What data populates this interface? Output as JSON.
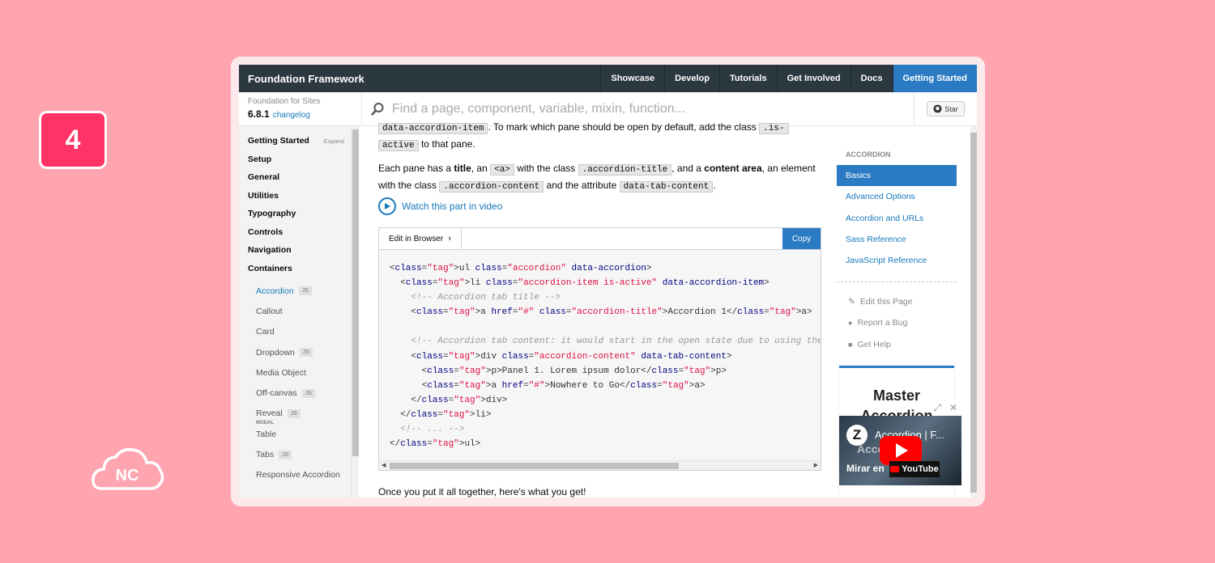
{
  "badge": "4",
  "logo": "NC",
  "topbar": {
    "brand": "Foundation Framework",
    "nav": [
      "Showcase",
      "Develop",
      "Tutorials",
      "Get Involved",
      "Docs"
    ],
    "active": "Getting Started"
  },
  "version": {
    "label": "Foundation for Sites",
    "number": "6.8.1",
    "changelog": "changelog"
  },
  "search": {
    "placeholder": "Find a page, component, variable, mixin, function..."
  },
  "github": {
    "star": "Star"
  },
  "sidebar": {
    "categories": [
      {
        "label": "Getting Started",
        "expand": "Expand"
      },
      {
        "label": "Setup"
      },
      {
        "label": "General"
      },
      {
        "label": "Utilities"
      },
      {
        "label": "Typography"
      },
      {
        "label": "Controls"
      },
      {
        "label": "Navigation"
      },
      {
        "label": "Containers"
      }
    ],
    "items": [
      {
        "label": "Accordion",
        "badge": "JS"
      },
      {
        "label": "Callout"
      },
      {
        "label": "Card"
      },
      {
        "label": "Dropdown",
        "badge": "JS"
      },
      {
        "label": "Media Object"
      },
      {
        "label": "Off-canvas",
        "badge": "JS"
      },
      {
        "label": "Reveal",
        "badge": "JS",
        "sub": "MODAL"
      },
      {
        "label": "Table"
      },
      {
        "label": "Tabs",
        "badge": "JS"
      },
      {
        "label": "Responsive Accordion"
      }
    ]
  },
  "main": {
    "p0": {
      "code1": "data-accordion-item",
      "text1": ". To mark which pane should be open by default, add the class ",
      "code2": ".is-",
      "code3": "active",
      "text2": " to that pane."
    },
    "p1": {
      "t1": "Each pane has a ",
      "b1": "title",
      "t2": ", an ",
      "c1": "<a>",
      "t3": " with the class ",
      "c2": ".accordion-title",
      "t4": ", and a ",
      "b2": "content area",
      "t5": ", an element with the class ",
      "c3": ".accordion-content",
      "t6": " and the attribute ",
      "c4": "data-tab-content",
      "t7": "."
    },
    "video_link": "Watch this part in video",
    "codebar": {
      "edit": "Edit in Browser",
      "copy": "Copy"
    },
    "code_lines": [
      "<ul class=\"accordion\" data-accordion>",
      "  <li class=\"accordion-item is-active\" data-accordion-item>",
      "    <!-- Accordion tab title -->",
      "    <a href=\"#\" class=\"accordion-title\">Accordion 1</a>",
      "",
      "    <!-- Accordion tab content: it would start in the open state due to using the",
      "    <div class=\"accordion-content\" data-tab-content>",
      "      <p>Panel 1. Lorem ipsum dolor</p>",
      "      <a href=\"#\">Nowhere to Go</a>",
      "    </div>",
      "  </li>",
      "  <!-- ... -->",
      "</ul>"
    ],
    "p2": "Once you put it all together, here's what you get!"
  },
  "right": {
    "header": "ACCORDION",
    "links": [
      "Basics",
      "Advanced Options",
      "Accordion and URLs",
      "Sass Reference",
      "JavaScript Reference"
    ],
    "active": "Basics",
    "actions": [
      "Edit this Page",
      "Report a Bug",
      "Get Help"
    ]
  },
  "ad": {
    "title_line1": "Master",
    "title_line2": "Accordion",
    "video_title": "Accordion | F...",
    "video_bg": "Accor",
    "watch_on": "Mirar en",
    "platform": "YouTube"
  },
  "colors": {
    "topbar": "#2c3840",
    "accent": "#2a7bc3",
    "link": "#1779ba",
    "background": "#ffa5b0",
    "badge": "#ff3366"
  }
}
